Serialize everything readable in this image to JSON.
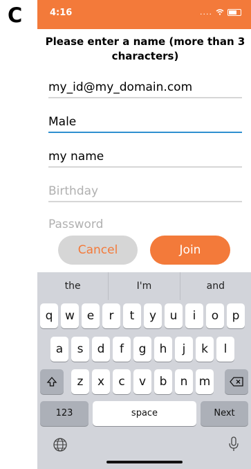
{
  "figure_label": "C",
  "status": {
    "time": "4:16"
  },
  "prompt": "Please enter a name (more than 3 characters)",
  "fields": {
    "email": "my_id@my_domain.com",
    "gender": "Male",
    "name": "my name",
    "birthday_placeholder": "Birthday",
    "password_placeholder": "Password"
  },
  "buttons": {
    "cancel": "Cancel",
    "join": "Join"
  },
  "keyboard": {
    "suggestions": [
      "the",
      "I'm",
      "and"
    ],
    "row1": [
      "q",
      "w",
      "e",
      "r",
      "t",
      "y",
      "u",
      "i",
      "o",
      "p"
    ],
    "row2": [
      "a",
      "s",
      "d",
      "f",
      "g",
      "h",
      "j",
      "k",
      "l"
    ],
    "row3": [
      "z",
      "x",
      "c",
      "v",
      "b",
      "n",
      "m"
    ],
    "numbers_key": "123",
    "space_key": "space",
    "next_key": "Next"
  },
  "icons": [
    "wifi-icon",
    "battery-icon",
    "shift-icon",
    "backspace-icon",
    "globe-icon",
    "microphone-icon"
  ]
}
